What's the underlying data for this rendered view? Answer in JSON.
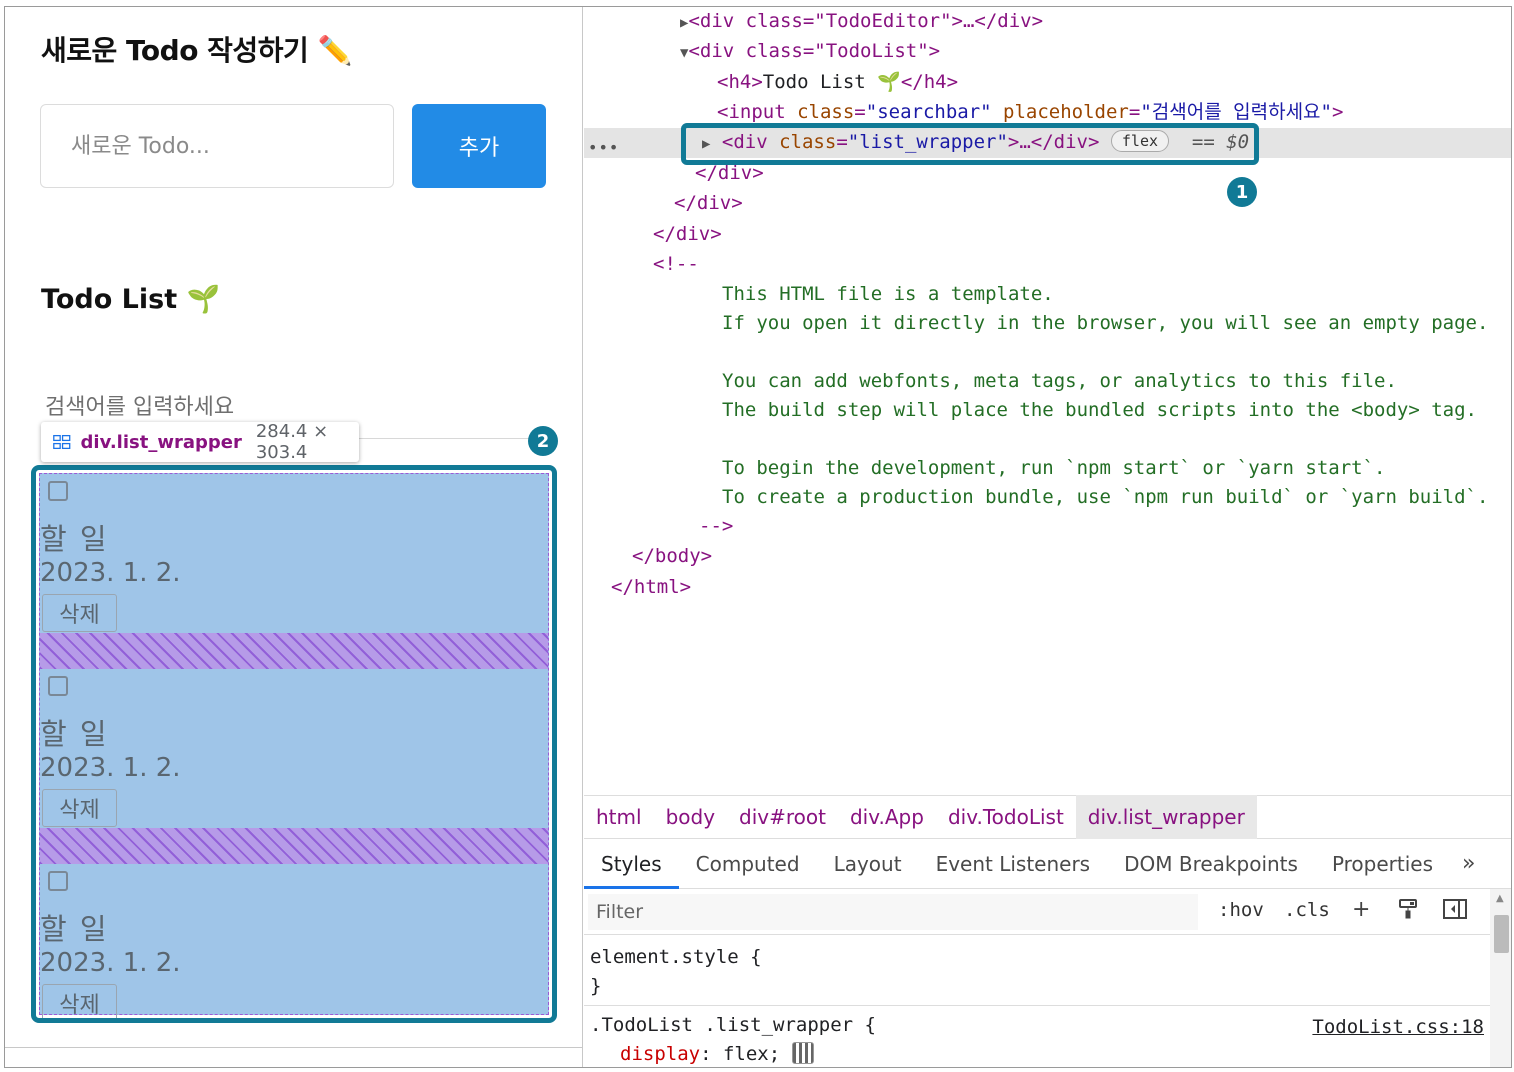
{
  "app": {
    "editor_title": "새로운 Todo 작성하기 ✏️",
    "input_placeholder": "새로운 Todo...",
    "add_button": "추가",
    "list_title": "Todo List 🌱",
    "search_placeholder": "검색어를 입력하세요",
    "items": [
      {
        "content": "할 일",
        "date": "2023. 1. 2.",
        "delete_label": "삭제",
        "checked": false
      },
      {
        "content": "할 일",
        "date": "2023. 1. 2.",
        "delete_label": "삭제",
        "checked": false
      },
      {
        "content": "할 일",
        "date": "2023. 1. 2.",
        "delete_label": "삭제",
        "checked": false
      }
    ]
  },
  "tooltip": {
    "name": "div.list_wrapper",
    "dims": "284.4 × 303.4"
  },
  "badges": {
    "one": "1",
    "two": "2"
  },
  "elements_tree": {
    "l1_pre": "<div class=\"TodoEditor\">",
    "l1_post": "…</div>",
    "l2": "<div class=\"TodoList\">",
    "l3_open": "<h4>",
    "l3_text": "Todo List 🌱",
    "l3_close": "</h4>",
    "l4_tag": "<input",
    "l4_attr1": "class",
    "l4_val1": "\"searchbar\"",
    "l4_attr2": "placeholder",
    "l4_val2": "\"검색어를 입력하세요\"",
    "l4_end": ">",
    "l5_tag": "<div",
    "l5_attr": "class",
    "l5_val": "\"list_wrapper\"",
    "l5_end": ">…</div>",
    "flex_badge": "flex",
    "selected_marker": "== $0",
    "close_div": "</div>",
    "comment_open": "<!--",
    "comment_lines": [
      "This HTML file is a template.",
      "If you open it directly in the browser, you will see an empty page.",
      "",
      "You can add webfonts, meta tags, or analytics to this file.",
      "The build step will place the bundled scripts into the <body> tag.",
      "",
      "To begin the development, run `npm start` or `yarn start`.",
      "To create a production bundle, use `npm run build` or `yarn build`."
    ],
    "comment_close": "-->",
    "body_close": "</body>",
    "html_close": "</html>"
  },
  "breadcrumbs": [
    "html",
    "body",
    "div#root",
    "div.App",
    "div.TodoList",
    "div.list_wrapper"
  ],
  "tabs": [
    "Styles",
    "Computed",
    "Layout",
    "Event Listeners",
    "DOM Breakpoints",
    "Properties",
    "»"
  ],
  "filter": {
    "placeholder": "Filter",
    "hov": ":hov",
    "cls": ".cls"
  },
  "styles": {
    "element_style": "element.style {",
    "close_brace": "}",
    "rule_selector": ".TodoList .list_wrapper {",
    "rule_source": "TodoList.css:18",
    "prop_name": "display",
    "prop_value": "flex;"
  },
  "colors": {
    "accent": "#228be6",
    "highlight": "#117a96",
    "tag": "#881280",
    "comment": "#236e25"
  },
  "icons": [
    "pencil-icon",
    "sprout-icon",
    "grid-layout-icon",
    "paint-icon",
    "toggle-sidebar-icon"
  ]
}
